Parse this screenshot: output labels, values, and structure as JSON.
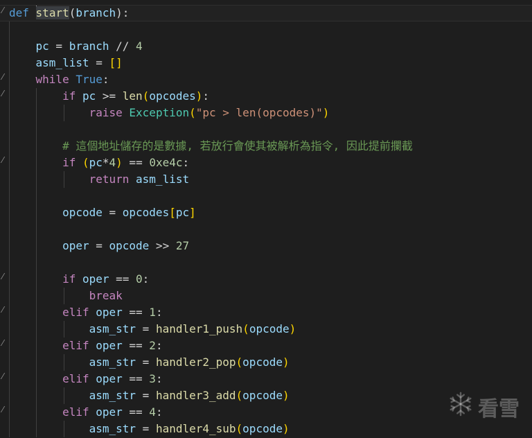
{
  "editor": {
    "line_indicators": [
      {
        "row": 0,
        "glyph": "⁄"
      },
      {
        "row": 4,
        "glyph": "⁄"
      },
      {
        "row": 5,
        "glyph": "⁄"
      },
      {
        "row": 9,
        "glyph": "⁄"
      },
      {
        "row": 16,
        "glyph": "⁄"
      },
      {
        "row": 18,
        "glyph": "⁄"
      },
      {
        "row": 20,
        "glyph": "⁄"
      },
      {
        "row": 22,
        "glyph": "⁄"
      },
      {
        "row": 24,
        "glyph": "⁄"
      }
    ],
    "lines": [
      [
        [
          "kw",
          "def"
        ],
        [
          "op",
          " "
        ],
        [
          "fn",
          "start"
        ],
        [
          "op",
          "("
        ],
        [
          "var",
          "branch"
        ],
        [
          "op",
          "):"
        ]
      ],
      [],
      [
        [
          "op",
          "    "
        ],
        [
          "var",
          "pc"
        ],
        [
          "op",
          " = "
        ],
        [
          "var",
          "branch"
        ],
        [
          "op",
          " // "
        ],
        [
          "num",
          "4"
        ]
      ],
      [
        [
          "op",
          "    "
        ],
        [
          "var",
          "asm_list"
        ],
        [
          "op",
          " = "
        ],
        [
          "b1",
          "[]"
        ]
      ],
      [
        [
          "op",
          "    "
        ],
        [
          "ctrl",
          "while"
        ],
        [
          "op",
          " "
        ],
        [
          "kw",
          "True"
        ],
        [
          "op",
          ":"
        ]
      ],
      [
        [
          "op",
          "        "
        ],
        [
          "ctrl",
          "if"
        ],
        [
          "op",
          " "
        ],
        [
          "var",
          "pc"
        ],
        [
          "op",
          " >= "
        ],
        [
          "fn",
          "len"
        ],
        [
          "b1",
          "("
        ],
        [
          "var",
          "opcodes"
        ],
        [
          "b1",
          ")"
        ],
        [
          "op",
          ":"
        ]
      ],
      [
        [
          "op",
          "            "
        ],
        [
          "ctrl",
          "raise"
        ],
        [
          "op",
          " "
        ],
        [
          "cls",
          "Exception"
        ],
        [
          "b1",
          "("
        ],
        [
          "str",
          "\"pc > len(opcodes)\""
        ],
        [
          "b1",
          ")"
        ]
      ],
      [],
      [
        [
          "op",
          "        "
        ],
        [
          "cmt",
          "# 這個地址儲存的是數據, 若放行會使其被解析為指令, 因此提前攔截"
        ]
      ],
      [
        [
          "op",
          "        "
        ],
        [
          "ctrl",
          "if"
        ],
        [
          "op",
          " "
        ],
        [
          "b1",
          "("
        ],
        [
          "var",
          "pc"
        ],
        [
          "op",
          "*"
        ],
        [
          "num",
          "4"
        ],
        [
          "b1",
          ")"
        ],
        [
          "op",
          " == "
        ],
        [
          "num",
          "0xe4c"
        ],
        [
          "op",
          ":"
        ]
      ],
      [
        [
          "op",
          "            "
        ],
        [
          "ctrl",
          "return"
        ],
        [
          "op",
          " "
        ],
        [
          "var",
          "asm_list"
        ]
      ],
      [],
      [
        [
          "op",
          "        "
        ],
        [
          "var",
          "opcode"
        ],
        [
          "op",
          " = "
        ],
        [
          "var",
          "opcodes"
        ],
        [
          "b1",
          "["
        ],
        [
          "var",
          "pc"
        ],
        [
          "b1",
          "]"
        ]
      ],
      [],
      [
        [
          "op",
          "        "
        ],
        [
          "var",
          "oper"
        ],
        [
          "op",
          " = "
        ],
        [
          "var",
          "opcode"
        ],
        [
          "op",
          " >> "
        ],
        [
          "num",
          "27"
        ]
      ],
      [],
      [
        [
          "op",
          "        "
        ],
        [
          "ctrl",
          "if"
        ],
        [
          "op",
          " "
        ],
        [
          "var",
          "oper"
        ],
        [
          "op",
          " == "
        ],
        [
          "num",
          "0"
        ],
        [
          "op",
          ":"
        ]
      ],
      [
        [
          "op",
          "            "
        ],
        [
          "ctrl",
          "break"
        ]
      ],
      [
        [
          "op",
          "        "
        ],
        [
          "ctrl",
          "elif"
        ],
        [
          "op",
          " "
        ],
        [
          "var",
          "oper"
        ],
        [
          "op",
          " == "
        ],
        [
          "num",
          "1"
        ],
        [
          "op",
          ":"
        ]
      ],
      [
        [
          "op",
          "            "
        ],
        [
          "var",
          "asm_str"
        ],
        [
          "op",
          " = "
        ],
        [
          "fn",
          "handler1_push"
        ],
        [
          "b1",
          "("
        ],
        [
          "var",
          "opcode"
        ],
        [
          "b1",
          ")"
        ]
      ],
      [
        [
          "op",
          "        "
        ],
        [
          "ctrl",
          "elif"
        ],
        [
          "op",
          " "
        ],
        [
          "var",
          "oper"
        ],
        [
          "op",
          " == "
        ],
        [
          "num",
          "2"
        ],
        [
          "op",
          ":"
        ]
      ],
      [
        [
          "op",
          "            "
        ],
        [
          "var",
          "asm_str"
        ],
        [
          "op",
          " = "
        ],
        [
          "fn",
          "handler2_pop"
        ],
        [
          "b1",
          "("
        ],
        [
          "var",
          "opcode"
        ],
        [
          "b1",
          ")"
        ]
      ],
      [
        [
          "op",
          "        "
        ],
        [
          "ctrl",
          "elif"
        ],
        [
          "op",
          " "
        ],
        [
          "var",
          "oper"
        ],
        [
          "op",
          " == "
        ],
        [
          "num",
          "3"
        ],
        [
          "op",
          ":"
        ]
      ],
      [
        [
          "op",
          "            "
        ],
        [
          "var",
          "asm_str"
        ],
        [
          "op",
          " = "
        ],
        [
          "fn",
          "handler3_add"
        ],
        [
          "b1",
          "("
        ],
        [
          "var",
          "opcode"
        ],
        [
          "b1",
          ")"
        ]
      ],
      [
        [
          "op",
          "        "
        ],
        [
          "ctrl",
          "elif"
        ],
        [
          "op",
          " "
        ],
        [
          "var",
          "oper"
        ],
        [
          "op",
          " == "
        ],
        [
          "num",
          "4"
        ],
        [
          "op",
          ":"
        ]
      ],
      [
        [
          "op",
          "            "
        ],
        [
          "var",
          "asm_str"
        ],
        [
          "op",
          " = "
        ],
        [
          "fn",
          "handler4_sub"
        ],
        [
          "b1",
          "("
        ],
        [
          "var",
          "opcode"
        ],
        [
          "b1",
          ")"
        ]
      ]
    ]
  },
  "watermark": {
    "text": "看雪",
    "icon": "snowflake-icon"
  },
  "colors": {
    "background": "#1e1e1e",
    "keyword": "#569cd6",
    "control": "#c586c0",
    "function": "#dcdcaa",
    "variable": "#9cdcfe",
    "number": "#b5cea8",
    "string": "#ce9178",
    "class": "#4ec9b0",
    "comment": "#6a9955",
    "bracket": "#ffd700"
  }
}
